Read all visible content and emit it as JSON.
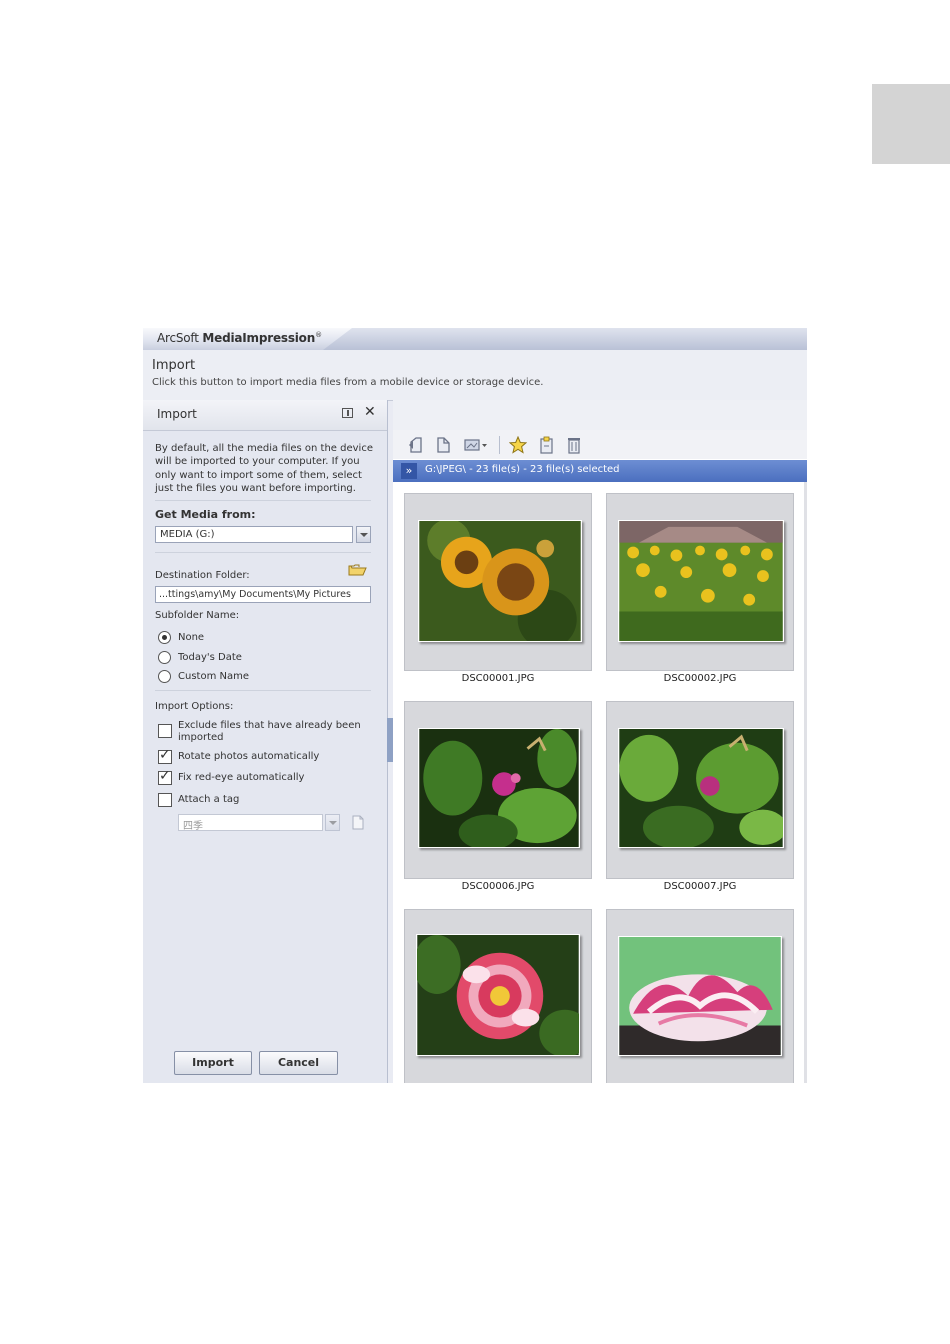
{
  "app": {
    "brand_light": "ArcSoft",
    "brand_bold": "MediaImpression",
    "brand_mark": "®"
  },
  "header": {
    "title": "Import",
    "subtitle": "Click this button to import media files from a mobile device or storage device."
  },
  "panel": {
    "title": "Import",
    "description": "By default, all the media files on the device will be imported to your computer. If you only want to import some of them, select just the files you want before importing.",
    "get_media_label": "Get Media from:",
    "get_media_value": "MEDIA (G:)",
    "destination_label": "Destination Folder:",
    "destination_value": "...ttings\\amy\\My Documents\\My Pictures",
    "subfolder_label": "Subfolder Name:",
    "subfolder_options": [
      {
        "label": "None",
        "selected": true
      },
      {
        "label": "Today's Date",
        "selected": false
      },
      {
        "label": "Custom Name",
        "selected": false
      }
    ],
    "import_options_label": "Import Options:",
    "import_options": [
      {
        "label": "Exclude files that have already been imported",
        "checked": false
      },
      {
        "label": "Rotate photos automatically",
        "checked": true
      },
      {
        "label": "Fix red-eye automatically",
        "checked": true
      },
      {
        "label": "Attach a tag",
        "checked": false
      }
    ],
    "tag_value": "四季",
    "import_button": "Import",
    "cancel_button": "Cancel"
  },
  "browser": {
    "path_text": "G:\\JPEG\\ - 23 file(s)   - 23 file(s) selected",
    "thumbnails": [
      {
        "name": "DSC00001.JPG",
        "colors": [
          "#3f5b1b",
          "#e2a41a",
          "#6a3b10"
        ]
      },
      {
        "name": "DSC00002.JPG",
        "colors": [
          "#6a8a2c",
          "#e8c11f",
          "#7c5b5c"
        ]
      },
      {
        "name": "DSC00006.JPG",
        "colors": [
          "#1f3a12",
          "#5e9b2e",
          "#c0308a"
        ]
      },
      {
        "name": "DSC00007.JPG",
        "colors": [
          "#23461a",
          "#6ba53a",
          "#b0367f"
        ]
      },
      {
        "name": "",
        "colors": [
          "#244a1b",
          "#e34c6d",
          "#f3c3d0"
        ]
      },
      {
        "name": "",
        "colors": [
          "#6fc27a",
          "#d63f7c",
          "#f2e0ea"
        ]
      }
    ]
  },
  "colors": {
    "accent": "#4b6fbf",
    "panel_bg": "#e4e7f0",
    "thumb_bg": "#d7d8dc"
  }
}
